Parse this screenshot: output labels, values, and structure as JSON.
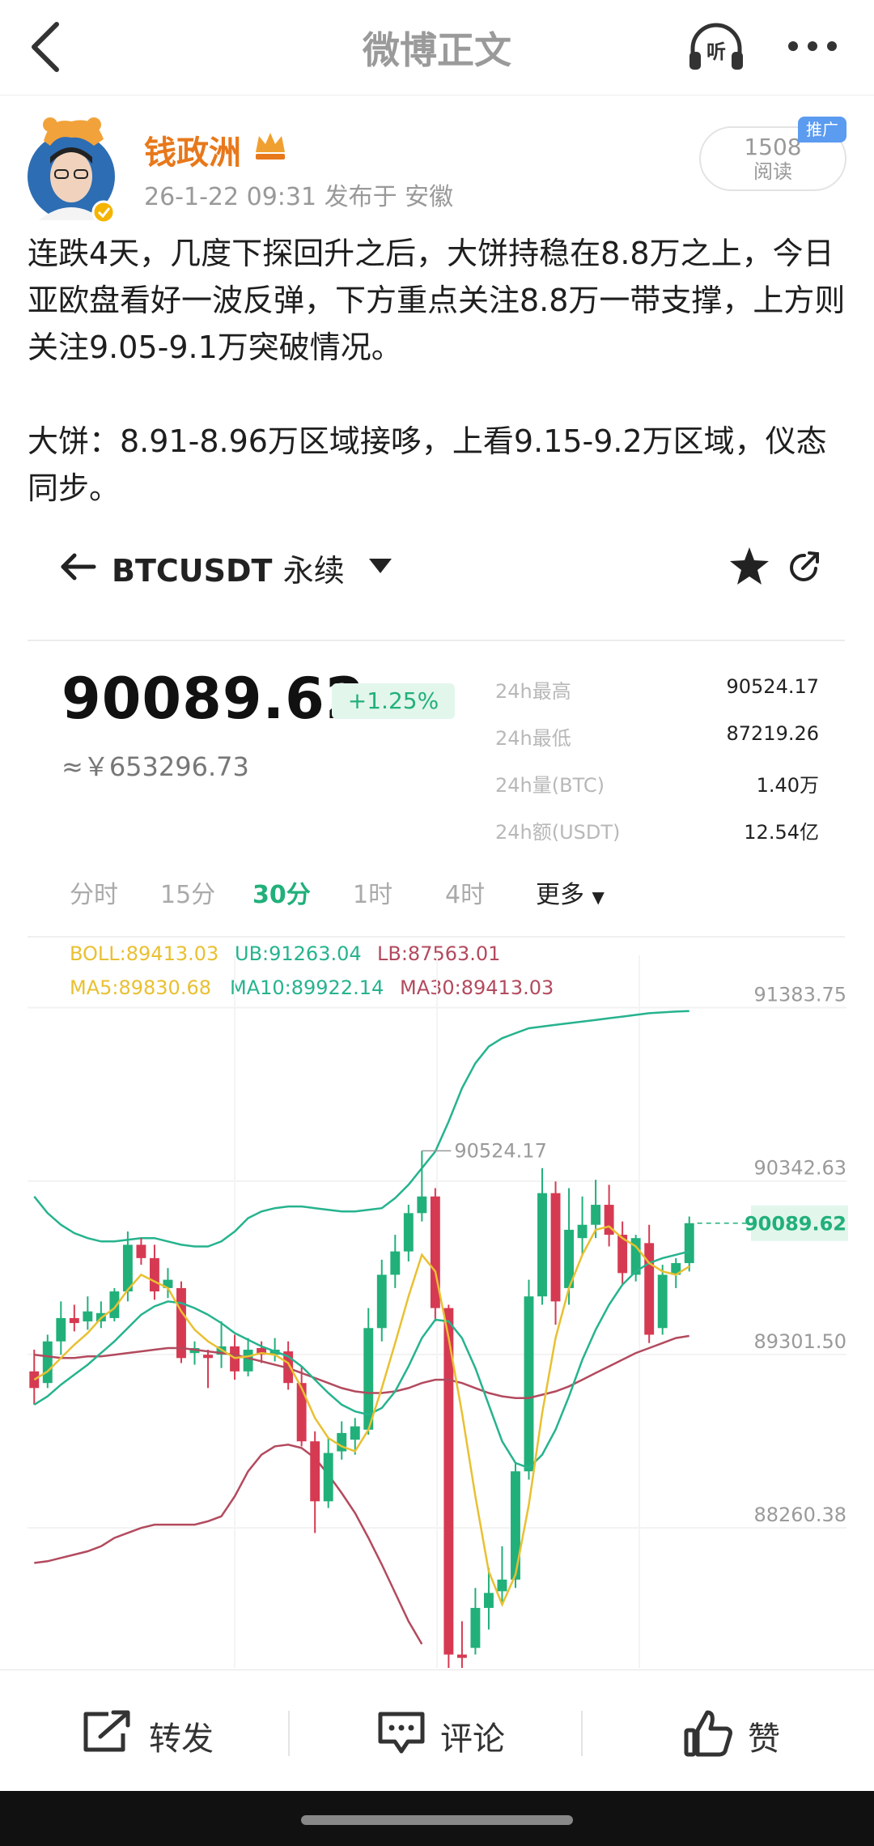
{
  "nav": {
    "title": "微博正文"
  },
  "author": {
    "name": "钱政洲",
    "meta": "26-1-22 09:31  发布于 安徽",
    "reads": "1508",
    "reads_label": "阅读",
    "promo_tag": "推广"
  },
  "post": {
    "paragraph1": "连跌4天，几度下探回升之后，大饼持稳在8.8万之上，今日亚欧盘看好一波反弹，下方重点关注8.8万一带支撑，上方则关注9.05-9.1万突破情况。",
    "paragraph2": "大饼：8.91-8.96万区域接哆，上看9.15-9.2万区域，仪态同步。"
  },
  "market": {
    "symbol": "BTCUSDT",
    "contract": "永续",
    "price": "90089.62",
    "change": "+1.25%",
    "cny": "≈￥653296.73",
    "stats": [
      {
        "label": "24h最高",
        "value": "90524.17"
      },
      {
        "label": "24h最低",
        "value": "87219.26"
      },
      {
        "label": "24h量(BTC)",
        "value": "1.40万"
      },
      {
        "label": "24h额(USDT)",
        "value": "12.54亿"
      }
    ],
    "timeframes": [
      "分时",
      "15分",
      "30分",
      "1时",
      "4时"
    ],
    "timeframe_more": "更多",
    "active_timeframe": "30分",
    "indicators": {
      "boll": "BOLL:89413.03",
      "ub": "UB:91263.04",
      "lb": "LB:87563.01",
      "ma5": "MA5:89830.68",
      "ma10": "MA10:89922.14",
      "ma30": "MA30:89413.03"
    },
    "colors": {
      "up": "#21b07a",
      "down": "#d63a52",
      "ma5": "#e9c031",
      "ma10": "#26b38e",
      "ma30": "#b34a5e",
      "boll": "#26b38e"
    }
  },
  "chart_data": {
    "type": "candlestick",
    "y_ticks": [
      91383.75,
      90342.63,
      89301.5,
      88260.38
    ],
    "ylim": [
      87420,
      91600
    ],
    "high_label": "90524.17",
    "last_price": "90089.62",
    "candles": [
      {
        "o": 89200,
        "h": 89330,
        "l": 89000,
        "c": 89100
      },
      {
        "o": 89130,
        "h": 89420,
        "l": 89100,
        "c": 89380
      },
      {
        "o": 89380,
        "h": 89620,
        "l": 89300,
        "c": 89520
      },
      {
        "o": 89520,
        "h": 89600,
        "l": 89440,
        "c": 89490
      },
      {
        "o": 89500,
        "h": 89650,
        "l": 89450,
        "c": 89560
      },
      {
        "o": 89500,
        "h": 89620,
        "l": 89460,
        "c": 89550
      },
      {
        "o": 89520,
        "h": 89700,
        "l": 89500,
        "c": 89680
      },
      {
        "o": 89680,
        "h": 90040,
        "l": 89620,
        "c": 89960
      },
      {
        "o": 89960,
        "h": 90000,
        "l": 89840,
        "c": 89880
      },
      {
        "o": 89880,
        "h": 89960,
        "l": 89630,
        "c": 89680
      },
      {
        "o": 89700,
        "h": 89820,
        "l": 89640,
        "c": 89750
      },
      {
        "o": 89700,
        "h": 89740,
        "l": 89250,
        "c": 89280
      },
      {
        "o": 89310,
        "h": 89380,
        "l": 89240,
        "c": 89340
      },
      {
        "o": 89300,
        "h": 89330,
        "l": 89100,
        "c": 89280
      },
      {
        "o": 89300,
        "h": 89500,
        "l": 89220,
        "c": 89350
      },
      {
        "o": 89350,
        "h": 89420,
        "l": 89150,
        "c": 89200
      },
      {
        "o": 89200,
        "h": 89400,
        "l": 89170,
        "c": 89330
      },
      {
        "o": 89340,
        "h": 89380,
        "l": 89250,
        "c": 89300
      },
      {
        "o": 89300,
        "h": 89400,
        "l": 89260,
        "c": 89330
      },
      {
        "o": 89320,
        "h": 89380,
        "l": 89090,
        "c": 89130
      },
      {
        "o": 89130,
        "h": 89230,
        "l": 88750,
        "c": 88780
      },
      {
        "o": 88780,
        "h": 88840,
        "l": 88230,
        "c": 88420
      },
      {
        "o": 88420,
        "h": 88800,
        "l": 88380,
        "c": 88710
      },
      {
        "o": 88720,
        "h": 88900,
        "l": 88670,
        "c": 88830
      },
      {
        "o": 88790,
        "h": 88920,
        "l": 88700,
        "c": 88870
      },
      {
        "o": 88850,
        "h": 89580,
        "l": 88820,
        "c": 89460
      },
      {
        "o": 89460,
        "h": 89870,
        "l": 89380,
        "c": 89780
      },
      {
        "o": 89780,
        "h": 90020,
        "l": 89700,
        "c": 89920
      },
      {
        "o": 89920,
        "h": 90200,
        "l": 89860,
        "c": 90150
      },
      {
        "o": 90150,
        "h": 90524,
        "l": 90100,
        "c": 90250
      },
      {
        "o": 90250,
        "h": 90300,
        "l": 89500,
        "c": 89580
      },
      {
        "o": 89580,
        "h": 89600,
        "l": 87420,
        "c": 87500
      },
      {
        "o": 87500,
        "h": 87700,
        "l": 87420,
        "c": 87480
      },
      {
        "o": 87540,
        "h": 87900,
        "l": 87500,
        "c": 87780
      },
      {
        "o": 87780,
        "h": 88020,
        "l": 87650,
        "c": 87870
      },
      {
        "o": 87880,
        "h": 88150,
        "l": 87800,
        "c": 87950
      },
      {
        "o": 87950,
        "h": 88650,
        "l": 87900,
        "c": 88600
      },
      {
        "o": 88600,
        "h": 89750,
        "l": 88550,
        "c": 89650
      },
      {
        "o": 89650,
        "h": 90420,
        "l": 89600,
        "c": 90270
      },
      {
        "o": 90270,
        "h": 90340,
        "l": 89480,
        "c": 89620
      },
      {
        "o": 89700,
        "h": 90300,
        "l": 89600,
        "c": 90050
      },
      {
        "o": 90000,
        "h": 90250,
        "l": 89900,
        "c": 90080
      },
      {
        "o": 90080,
        "h": 90350,
        "l": 90000,
        "c": 90200
      },
      {
        "o": 90200,
        "h": 90320,
        "l": 89950,
        "c": 90020
      },
      {
        "o": 90020,
        "h": 90100,
        "l": 89720,
        "c": 89790
      },
      {
        "o": 89780,
        "h": 90020,
        "l": 89740,
        "c": 90000
      },
      {
        "o": 89970,
        "h": 90080,
        "l": 89370,
        "c": 89420
      },
      {
        "o": 89460,
        "h": 89840,
        "l": 89420,
        "c": 89780
      },
      {
        "o": 89780,
        "h": 89880,
        "l": 89700,
        "c": 89850
      },
      {
        "o": 89850,
        "h": 90130,
        "l": 89800,
        "c": 90089.62
      }
    ],
    "ma5": [
      89150,
      89200,
      89280,
      89360,
      89430,
      89520,
      89580,
      89690,
      89780,
      89740,
      89700,
      89560,
      89450,
      89380,
      89330,
      89280,
      89290,
      89310,
      89300,
      89250,
      89100,
      88920,
      88800,
      88750,
      88720,
      88850,
      89100,
      89370,
      89650,
      89900,
      89800,
      89400,
      88950,
      88450,
      88000,
      87800,
      87980,
      88400,
      88950,
      89400,
      89700,
      89900,
      90050,
      90070,
      90000,
      89950,
      89850,
      89800,
      89780,
      89830
    ],
    "ma10": [
      89000,
      89050,
      89120,
      89180,
      89240,
      89310,
      89380,
      89460,
      89540,
      89590,
      89620,
      89610,
      89580,
      89540,
      89490,
      89430,
      89390,
      89350,
      89320,
      89290,
      89230,
      89150,
      89070,
      89000,
      88960,
      88940,
      88980,
      89080,
      89230,
      89400,
      89510,
      89500,
      89400,
      89220,
      89000,
      88780,
      88650,
      88620,
      88700,
      88850,
      89050,
      89270,
      89450,
      89600,
      89720,
      89800,
      89850,
      89880,
      89900,
      89920
    ],
    "ma30": [
      89300,
      89290,
      89280,
      89280,
      89290,
      89290,
      89300,
      89310,
      89320,
      89330,
      89340,
      89340,
      89330,
      89320,
      89310,
      89300,
      89280,
      89260,
      89240,
      89220,
      89190,
      89160,
      89130,
      89100,
      89080,
      89070,
      89070,
      89080,
      89100,
      89130,
      89150,
      89150,
      89130,
      89100,
      89070,
      89050,
      89040,
      89040,
      89060,
      89080,
      89110,
      89150,
      89190,
      89230,
      89270,
      89310,
      89340,
      89370,
      89400,
      89413
    ],
    "ub": [
      90250,
      90150,
      90080,
      90030,
      90000,
      89980,
      89980,
      89990,
      90000,
      90000,
      89980,
      89960,
      89950,
      89950,
      89980,
      90040,
      90120,
      90160,
      90180,
      90190,
      90190,
      90180,
      90170,
      90160,
      90160,
      90170,
      90180,
      90240,
      90320,
      90420,
      90520,
      90700,
      90900,
      91050,
      91150,
      91200,
      91230,
      91260,
      91270,
      91280,
      91290,
      91300,
      91310,
      91320,
      91330,
      91340,
      91350,
      91355,
      91360,
      91363
    ],
    "lb": [
      88050,
      88060,
      88080,
      88100,
      88120,
      88150,
      88200,
      88230,
      88260,
      88280,
      88280,
      88280,
      88280,
      88300,
      88330,
      88450,
      88600,
      88700,
      88750,
      88760,
      88740,
      88680,
      88580,
      88470,
      88350,
      88200,
      88040,
      87870,
      87700,
      87563
    ]
  }
}
